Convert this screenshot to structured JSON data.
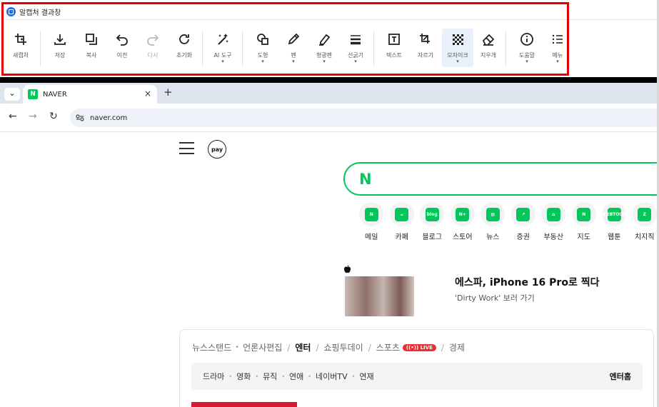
{
  "capture_window": {
    "title": "알캡처 결과창",
    "tools": [
      {
        "label": "새캡처",
        "icon": "new-capture-icon",
        "caret": false,
        "disabled": false,
        "active": false
      },
      {
        "label": "저장",
        "icon": "save-icon",
        "caret": false,
        "disabled": false,
        "active": false
      },
      {
        "label": "복사",
        "icon": "copy-icon",
        "caret": false,
        "disabled": false,
        "active": false
      },
      {
        "label": "이전",
        "icon": "undo-icon",
        "caret": false,
        "disabled": false,
        "active": false
      },
      {
        "label": "다시",
        "icon": "redo-icon",
        "caret": false,
        "disabled": true,
        "active": false
      },
      {
        "label": "초기화",
        "icon": "reset-icon",
        "caret": false,
        "disabled": false,
        "active": false
      },
      {
        "label": "AI 도구",
        "icon": "ai-tools-icon",
        "caret": true,
        "disabled": false,
        "active": false
      },
      {
        "label": "도형",
        "icon": "shape-icon",
        "caret": true,
        "disabled": false,
        "active": false
      },
      {
        "label": "펜",
        "icon": "pen-icon",
        "caret": true,
        "disabled": false,
        "active": false
      },
      {
        "label": "형광펜",
        "icon": "highlighter-icon",
        "caret": true,
        "disabled": false,
        "active": false
      },
      {
        "label": "선굵기",
        "icon": "line-width-icon",
        "caret": true,
        "disabled": false,
        "active": false
      },
      {
        "label": "텍스트",
        "icon": "text-icon",
        "caret": false,
        "disabled": false,
        "active": false
      },
      {
        "label": "자르기",
        "icon": "crop-icon",
        "caret": false,
        "disabled": false,
        "active": false
      },
      {
        "label": "모자이크",
        "icon": "mosaic-icon",
        "caret": true,
        "disabled": false,
        "active": true
      },
      {
        "label": "지우개",
        "icon": "eraser-icon",
        "caret": false,
        "disabled": false,
        "active": false
      },
      {
        "label": "도움말",
        "icon": "help-icon",
        "caret": true,
        "disabled": false,
        "active": false
      },
      {
        "label": "메뉴",
        "icon": "menu-icon",
        "caret": true,
        "disabled": false,
        "active": false
      }
    ],
    "caret_glyph": "▾"
  },
  "browser": {
    "tab_title": "NAVER",
    "tab_favicon": "N",
    "tab_close": "×",
    "new_tab": "+",
    "url": "naver.com",
    "tab_dropdown": "⌄",
    "back": "←",
    "forward": "→",
    "reload": "↻"
  },
  "naver": {
    "pay_label": "pay",
    "search_logo": "N",
    "brand_color": "#03c75a",
    "shortcuts": [
      {
        "label": "메일",
        "glyph": "N"
      },
      {
        "label": "카페",
        "glyph": "☕"
      },
      {
        "label": "블로그",
        "glyph": "blog"
      },
      {
        "label": "스토어",
        "glyph": "N+"
      },
      {
        "label": "뉴스",
        "glyph": "▤"
      },
      {
        "label": "증권",
        "glyph": "↗"
      },
      {
        "label": "부동산",
        "glyph": "⌂"
      },
      {
        "label": "지도",
        "glyph": "N"
      },
      {
        "label": "웹툰",
        "glyph": "WEBTOON"
      },
      {
        "label": "치지직",
        "glyph": "Z"
      }
    ],
    "banner": {
      "logo_glyph": "",
      "title": "에스파, iPhone 16 Pro로 찍다",
      "subtitle": "'Dirty Work' 보러 가기"
    },
    "news": {
      "tabs": [
        {
          "label": "뉴스스탠드",
          "sep": "dot"
        },
        {
          "label": "언론사편집",
          "sep": "slash"
        },
        {
          "label": "엔터",
          "sep": "slash",
          "active": true
        },
        {
          "label": "쇼핑투데이",
          "sep": "slash"
        },
        {
          "label": "스포츠",
          "sep": "slash",
          "live": true
        },
        {
          "label": "경제",
          "sep": ""
        }
      ],
      "live_badge": "LIVE",
      "live_glyph": "((•))",
      "sub_items": [
        "드라마",
        "영화",
        "뮤직",
        "연애",
        "네이버TV",
        "연재"
      ],
      "home_link": "엔터홈"
    }
  }
}
